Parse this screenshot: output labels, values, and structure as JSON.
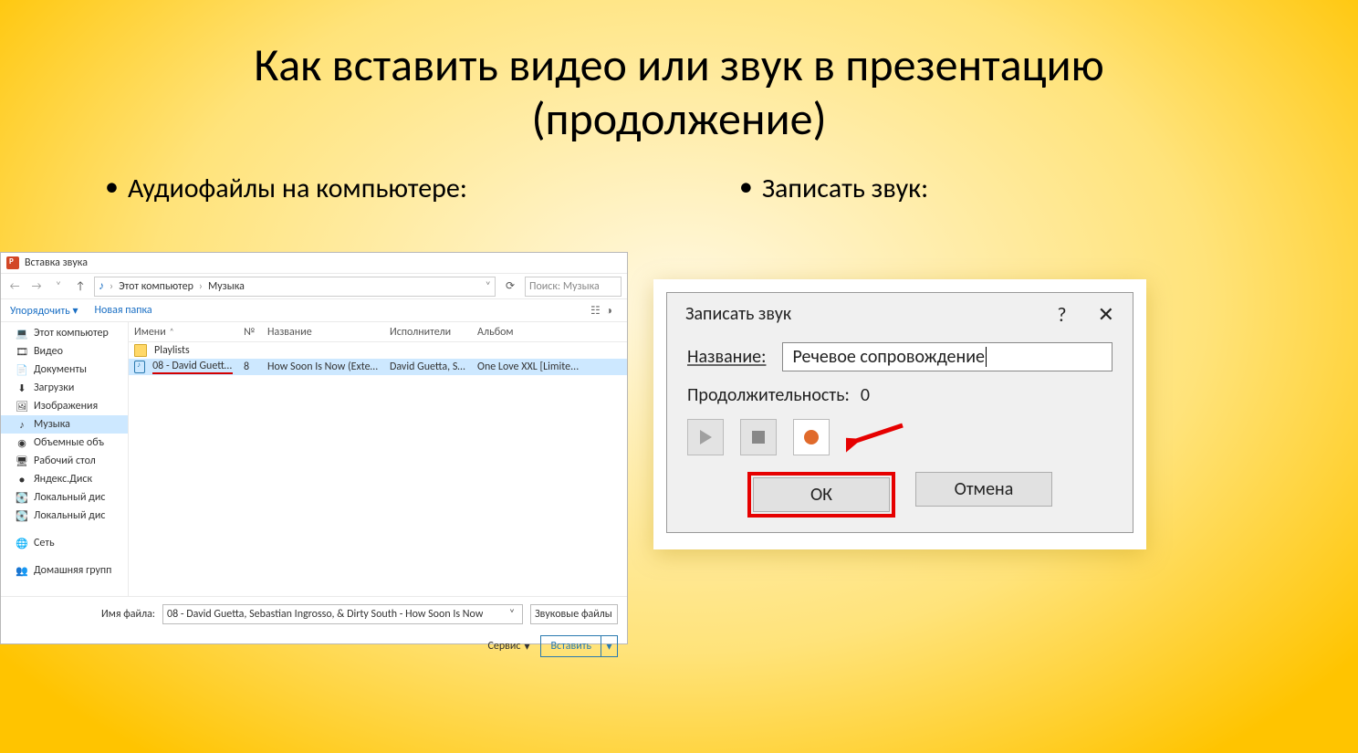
{
  "slide": {
    "title_line1": "Как вставить видео или звук в презентацию",
    "title_line2": "(продолжение)",
    "bullet_left": "Аудиофайлы на компьютере:",
    "bullet_right": "Записать звук:"
  },
  "file_dialog": {
    "title": "Вставка звука",
    "breadcrumb": {
      "root": "Этот компьютер",
      "folder": "Музыка"
    },
    "search_placeholder": "Поиск: Музыка",
    "toolbar": {
      "organize": "Упорядочить",
      "new_folder": "Новая папка"
    },
    "sidebar": [
      {
        "label": "Этот компьютер",
        "icon": "💻",
        "name": "sidebar-this-pc"
      },
      {
        "label": "Видео",
        "icon": "🎞",
        "name": "sidebar-videos"
      },
      {
        "label": "Документы",
        "icon": "📄",
        "name": "sidebar-documents"
      },
      {
        "label": "Загрузки",
        "icon": "⬇",
        "name": "sidebar-downloads"
      },
      {
        "label": "Изображения",
        "icon": "🖼",
        "name": "sidebar-pictures"
      },
      {
        "label": "Музыка",
        "icon": "♪",
        "name": "sidebar-music",
        "selected": true
      },
      {
        "label": "Объемные объ",
        "icon": "◉",
        "name": "sidebar-3d"
      },
      {
        "label": "Рабочий стол",
        "icon": "🖥",
        "name": "sidebar-desktop"
      },
      {
        "label": "Яндекс.Диск",
        "icon": "●",
        "name": "sidebar-yadisk"
      },
      {
        "label": "Локальный дис",
        "icon": "💽",
        "name": "sidebar-localdisk1"
      },
      {
        "label": "Локальный дис",
        "icon": "💽",
        "name": "sidebar-localdisk2"
      }
    ],
    "sidebar_group2": [
      {
        "label": "Сеть",
        "icon": "🌐",
        "name": "sidebar-network"
      }
    ],
    "sidebar_group3": [
      {
        "label": "Домашняя групп",
        "icon": "👥",
        "name": "sidebar-homegroup"
      }
    ],
    "columns": {
      "name": "Имени",
      "num": "№",
      "title": "Название",
      "artist": "Исполнители",
      "album": "Альбом"
    },
    "rows": [
      {
        "type": "folder",
        "name": "Playlists"
      },
      {
        "type": "audio",
        "selected": true,
        "name": "08 - David Guetta, S...",
        "num": "8",
        "title": "How Soon Is Now (Extend...",
        "artist": "David Guetta, Seb...",
        "album": "One Love XXL [Limite..."
      }
    ],
    "footer": {
      "filename_label": "Имя файла:",
      "filename_value": "08 - David Guetta, Sebastian Ingrosso, & Dirty South - How Soon Is Now",
      "filter": "Звуковые файлы",
      "tools": "Сервис",
      "insert": "Вставить"
    }
  },
  "record_dialog": {
    "title": "Записать звук",
    "name_label": "Название:",
    "name_value": "Речевое сопровождение",
    "duration_label": "Продолжительность:",
    "duration_value": "0",
    "ok": "ОК",
    "cancel": "Отмена"
  }
}
